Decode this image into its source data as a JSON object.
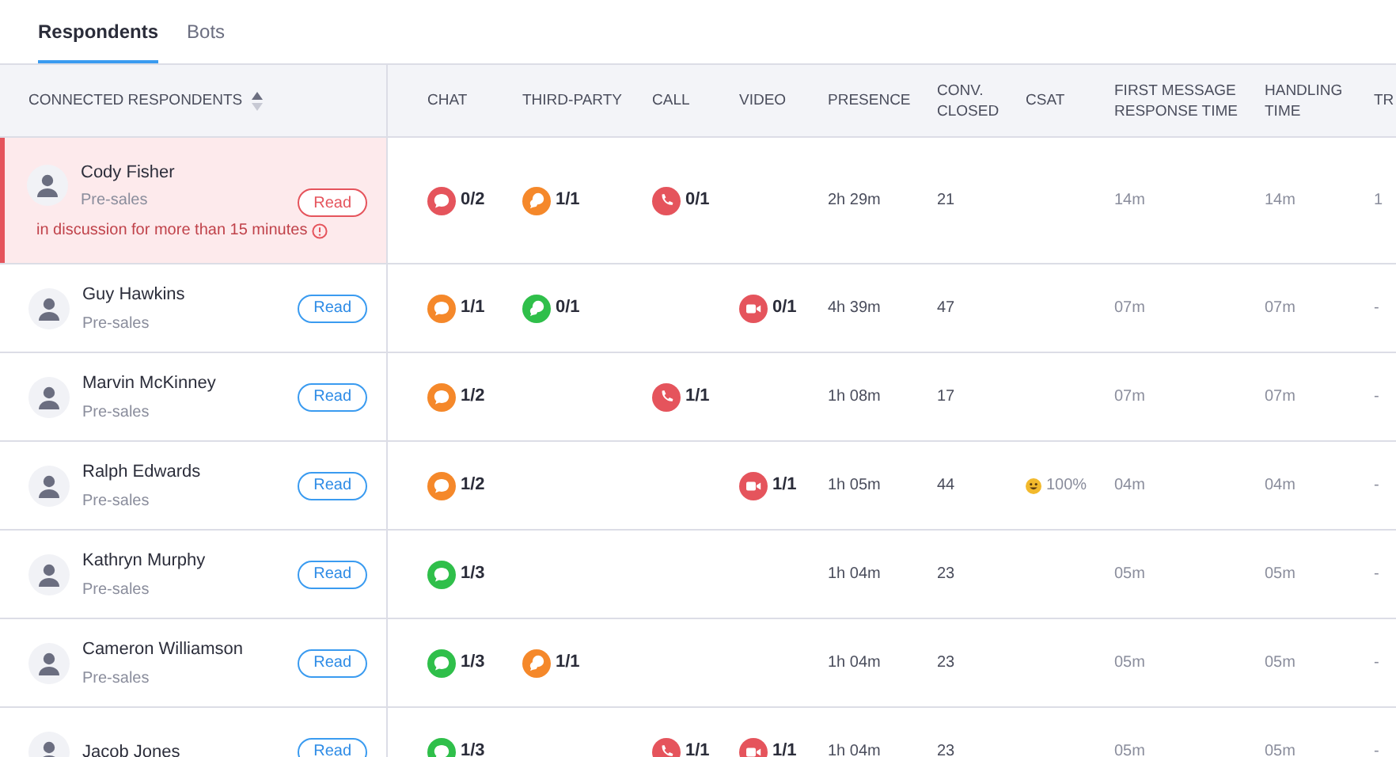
{
  "tabs": [
    {
      "label": "Respondents",
      "selected": true
    },
    {
      "label": "Bots",
      "selected": false
    }
  ],
  "columns": {
    "respondent": "CONNECTED RESPONDENTS",
    "chat": "CHAT",
    "third_party": "THIRD-PARTY",
    "call": "CALL",
    "video": "VIDEO",
    "presence": "PRESENCE",
    "conv_closed": "CONV. CLOSED",
    "csat": "CSAT",
    "first_response": "FIRST MESSAGE RESPONSE TIME",
    "handling": "HANDLING TIME",
    "column_11": "TR"
  },
  "rows": [
    {
      "name": "Cody Fisher",
      "team": "Pre-sales",
      "action": "Read",
      "alert": true,
      "warning": "in discussion for more than 15 minutes",
      "chat": {
        "count": "0/2",
        "color": "#e5545c"
      },
      "third_party": {
        "count": "1/1",
        "color": "#f5882a"
      },
      "call": {
        "count": "0/1",
        "color": "#e5545c"
      },
      "presence": "2h 29m",
      "conv_closed": "21",
      "first_response": "14m",
      "handling": "14m",
      "column_11": "1"
    },
    {
      "name": "Guy Hawkins",
      "team": "Pre-sales",
      "action": "Read",
      "alert": false,
      "chat": {
        "count": "1/1",
        "color": "#f5882a"
      },
      "third_party": {
        "count": "0/1",
        "color": "#2fbf4a"
      },
      "video": {
        "count": "0/1",
        "color": "#e5545c"
      },
      "presence": "4h 39m",
      "conv_closed": "47",
      "first_response": "07m",
      "handling": "07m",
      "column_11": "-"
    },
    {
      "name": "Marvin McKinney",
      "team": "Pre-sales",
      "action": "Read",
      "alert": false,
      "chat": {
        "count": "1/2",
        "color": "#f5882a"
      },
      "call": {
        "count": "1/1",
        "color": "#e5545c"
      },
      "presence": "1h 08m",
      "conv_closed": "17",
      "first_response": "07m",
      "handling": "07m",
      "column_11": "-"
    },
    {
      "name": "Ralph Edwards",
      "team": "Pre-sales",
      "action": "Read",
      "alert": false,
      "chat": {
        "count": "1/2",
        "color": "#f5882a"
      },
      "video": {
        "count": "1/1",
        "color": "#e5545c"
      },
      "presence": "1h 05m",
      "conv_closed": "44",
      "csat": "100%",
      "first_response": "04m",
      "handling": "04m",
      "column_11": "-"
    },
    {
      "name": "Kathryn Murphy",
      "team": "Pre-sales",
      "action": "Read",
      "alert": false,
      "chat": {
        "count": "1/3",
        "color": "#2fbf4a"
      },
      "presence": "1h 04m",
      "conv_closed": "23",
      "first_response": "05m",
      "handling": "05m",
      "column_11": "-"
    },
    {
      "name": "Cameron Williamson",
      "team": "Pre-sales",
      "action": "Read",
      "alert": false,
      "chat": {
        "count": "1/3",
        "color": "#2fbf4a"
      },
      "third_party": {
        "count": "1/1",
        "color": "#f5882a"
      },
      "presence": "1h 04m",
      "conv_closed": "23",
      "first_response": "05m",
      "handling": "05m",
      "column_11": "-"
    },
    {
      "name": "Jacob Jones",
      "action": "Read",
      "alert": false,
      "chat": {
        "count": "1/3",
        "color": "#2fbf4a"
      },
      "call": {
        "count": "1/1",
        "color": "#e5545c"
      },
      "video": {
        "count": "1/1",
        "color": "#e5545c"
      },
      "presence": "1h 04m",
      "conv_closed": "23",
      "first_response": "05m",
      "handling": "05m",
      "column_11": "-"
    }
  ]
}
